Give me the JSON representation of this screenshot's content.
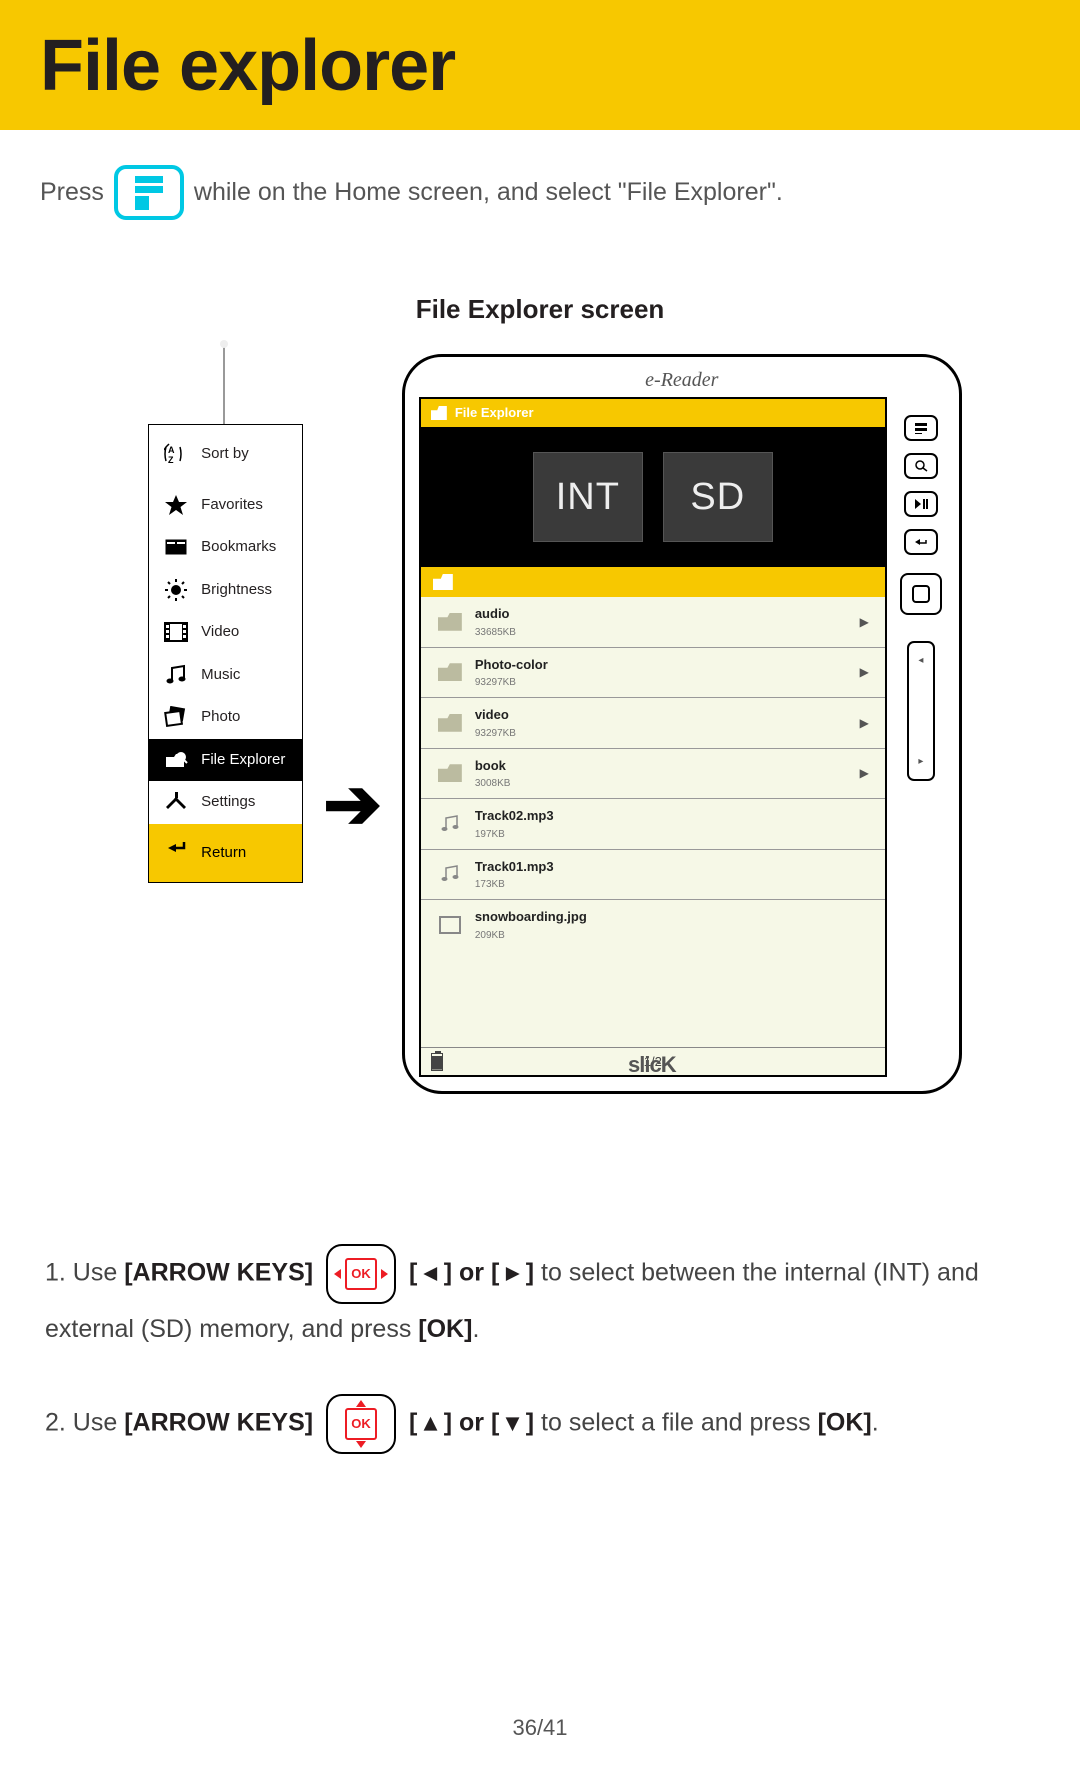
{
  "header": {
    "title": "File explorer"
  },
  "intro": {
    "pre": "Press",
    "post": "while on the Home screen, and select \"File Explorer\"."
  },
  "diagram_caption": "File Explorer screen",
  "side_menu": {
    "items": [
      {
        "label": "Sort by"
      },
      {
        "label": "Favorites"
      },
      {
        "label": "Bookmarks"
      },
      {
        "label": "Brightness"
      },
      {
        "label": "Video"
      },
      {
        "label": "Music"
      },
      {
        "label": "Photo"
      },
      {
        "label": "File Explorer"
      },
      {
        "label": "Settings"
      },
      {
        "label": "Return"
      }
    ]
  },
  "device": {
    "top_label": "e-Reader",
    "brand": "slicK",
    "titlebar": "File  Explorer",
    "drives": {
      "int": "INT",
      "sd": "SD"
    },
    "files": [
      {
        "name": "audio",
        "size": "33685KB",
        "type": "folder"
      },
      {
        "name": "Photo-color",
        "size": "93297KB",
        "type": "folder"
      },
      {
        "name": "video",
        "size": "93297KB",
        "type": "folder"
      },
      {
        "name": "book",
        "size": "3008KB",
        "type": "folder"
      },
      {
        "name": "Track02.mp3",
        "size": "197KB",
        "type": "music"
      },
      {
        "name": "Track01.mp3",
        "size": "173KB",
        "type": "music"
      },
      {
        "name": "snowboarding.jpg",
        "size": "209KB",
        "type": "image"
      }
    ],
    "page_indicator": "1/2"
  },
  "instructions": {
    "step1": {
      "num": "1. ",
      "pre": "Use ",
      "arrow_keys": "[ARROW KEYS]",
      "mid1": " [ ◂ ] or [ ▸ ] ",
      "post": "to select between the internal (INT) and external (SD) memory, and press ",
      "ok": "[OK]",
      "end": "."
    },
    "step2": {
      "num": "2. ",
      "pre": "Use ",
      "arrow_keys": "[ARROW KEYS]",
      "mid1": " [ ▴ ] or [ ▾ ] ",
      "post": "to select a file and press ",
      "ok": "[OK]",
      "end": "."
    }
  },
  "page_number": "36/41",
  "ok_label": "OK"
}
